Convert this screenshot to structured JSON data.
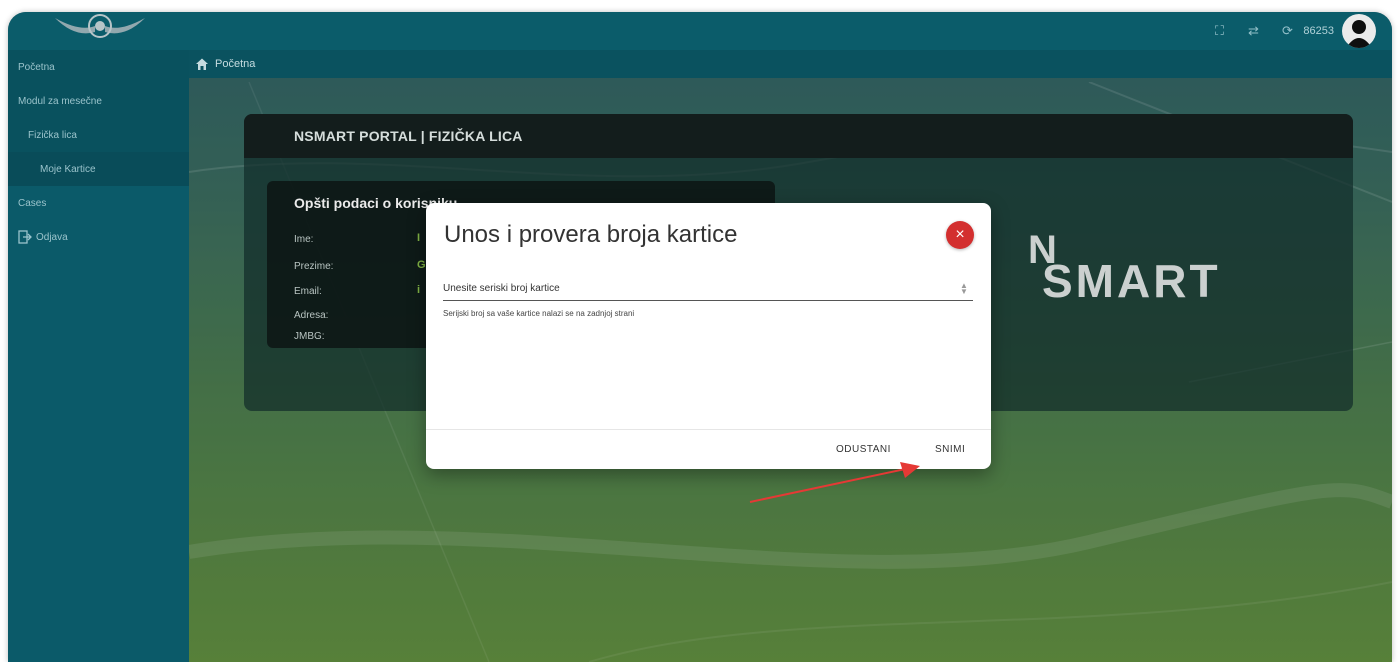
{
  "topbar": {
    "user_id": "86253",
    "icons": [
      "fullscreen-icon",
      "swap-icon",
      "refresh-icon",
      "user-avatar"
    ]
  },
  "breadcrumb": {
    "home_label": "Početna"
  },
  "sidebar": {
    "items": [
      {
        "label": "Početna"
      },
      {
        "label": "Modul za mesečne"
      },
      {
        "label": "Fizička lica"
      },
      {
        "label": "Moje Kartice"
      },
      {
        "label": "Cases"
      },
      {
        "label": "Odjava"
      }
    ]
  },
  "portal": {
    "header": "NSMART PORTAL | FIZIČKA LICA",
    "info_title": "Opšti podaci o korisniku",
    "rows": [
      {
        "label": "Ime:",
        "value": "I"
      },
      {
        "label": "Prezime:",
        "value": "G"
      },
      {
        "label": "Email:",
        "value": "i"
      },
      {
        "label": "Adresa:",
        "value": ""
      },
      {
        "label": "JMBG:",
        "value": ""
      }
    ],
    "logo_n": "N",
    "logo_smart": "SMART"
  },
  "modal": {
    "title": "Unos i provera broja kartice",
    "close_symbol": "×",
    "input_placeholder": "Unesite seriski broj kartice",
    "hint": "Serijski broj sa vaše kartice nalazi se na zadnjoj strani",
    "cancel_label": "ODUSTANI",
    "save_label": "SNIMI"
  },
  "colors": {
    "topbar": "#0d6474",
    "sidebar": "#0c6272",
    "close_button": "#d32f2f",
    "arrow": "#e53935",
    "value_green": "#8bc34a"
  }
}
